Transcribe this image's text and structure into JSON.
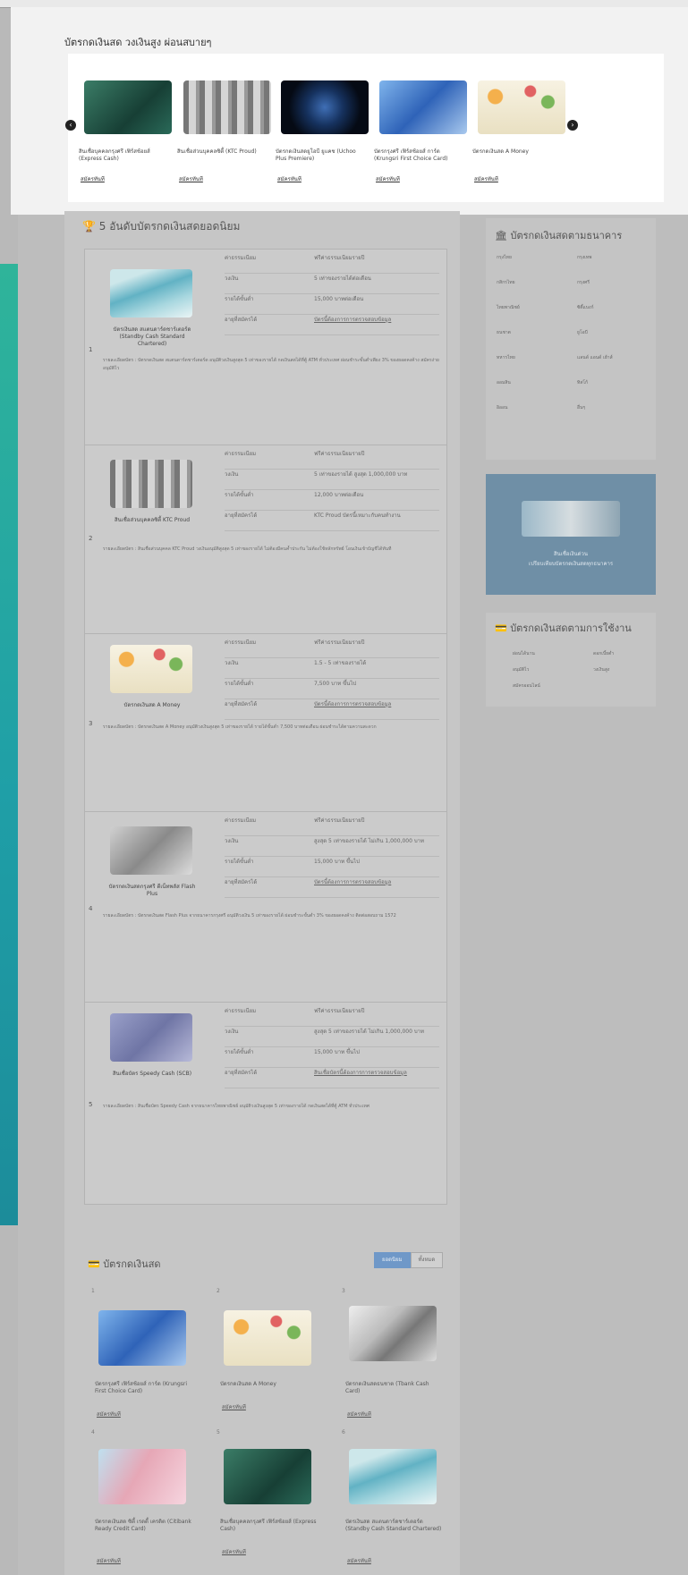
{
  "popup": {
    "title": "บัตรกดเงินสด วงเงินสูง ผ่อนสบายๆ",
    "cards": [
      {
        "caption": "สินเชื่อบุคคลกรุงศรี เฟิร์สช้อยส์ (Express Cash)",
        "link": "สมัครทันที"
      },
      {
        "caption": "สินเชื่อส่วนบุคคลซิตี้ (KTC Proud)",
        "link": "สมัครทันที"
      },
      {
        "caption": "บัตรกดเงินสดยูโอบี ยูแคช (Uchoo Plus Premiere)",
        "link": "สมัครทันที"
      },
      {
        "caption": "บัตรกรุงศรี เฟิร์สช้อยส์ การ์ด (Krungsri First Choice Card)",
        "link": "สมัครทันที"
      },
      {
        "caption": "บัตรกดเงินสด A Money",
        "link": "สมัครทันที"
      }
    ]
  },
  "main": {
    "title": "5 อันดับบัตรกดเงินสดยอดนิยม",
    "field_labels": [
      "ค่าธรรมเนียม",
      "วงเงิน",
      "รายได้ขั้นต่ำ",
      "อายุที่สมัครได้"
    ],
    "rows": [
      {
        "num": "1",
        "name": "บัตรเงินสด สแตนดาร์ดชาร์เตอร์ด (Standby Cash Standard Chartered)",
        "values": [
          "ฟรีค่าธรรมเนียมรายปี",
          "5 เท่าของรายได้ต่อเดือน",
          "15,000 บาทต่อเดือน",
          "บัตรนี้ต้องการการตรวจสอบข้อมูล"
        ],
        "detail": "รายละเอียดบัตร : บัตรกดเงินสด สแตนดาร์ดชาร์เตอร์ด อนุมัติวงเงินสูงสุด 5 เท่าของรายได้ กดเงินสดได้ที่ตู้ ATM ทั่วประเทศ ผ่อนชำระขั้นต่ำเพียง 3% ของยอดคงค้าง สมัครง่าย อนุมัติไว"
      },
      {
        "num": "2",
        "name": "สินเชื่อส่วนบุคคลซิตี้ KTC Proud",
        "values": [
          "ฟรีค่าธรรมเนียมรายปี",
          "5 เท่าของรายได้ สูงสุด 1,000,000 บาท",
          "12,000 บาทต่อเดือน",
          "KTC Proud บัตรนี้เหมาะกับคนทำงาน"
        ],
        "detail": "รายละเอียดบัตร : สินเชื่อส่วนบุคคล KTC Proud วงเงินอนุมัติสูงสุด 5 เท่าของรายได้ ไม่ต้องมีคนค้ำประกัน ไม่ต้องใช้หลักทรัพย์ โอนเงินเข้าบัญชีได้ทันที"
      },
      {
        "num": "3",
        "name": "บัตรกดเงินสด A Money",
        "values": [
          "ฟรีค่าธรรมเนียมรายปี",
          "1.5 - 5 เท่าของรายได้",
          "7,500 บาท ขึ้นไป",
          "บัตรนี้ต้องการการตรวจสอบข้อมูล"
        ],
        "detail": "รายละเอียดบัตร : บัตรกดเงินสด A Money อนุมัติวงเงินสูงสุด 5 เท่าของรายได้ รายได้ขั้นต่ำ 7,500 บาทต่อเดือน ผ่อนชำระได้ตามความสะดวก"
      },
      {
        "num": "4",
        "name": "บัตรกดเงินสดกรุงศรี ดีเน็ทพลัส Flash Plus",
        "values": [
          "ฟรีค่าธรรมเนียมรายปี",
          "สูงสุด 5 เท่าของรายได้ ไม่เกิน 1,000,000 บาท",
          "15,000 บาท ขึ้นไป",
          "บัตรนี้ต้องการการตรวจสอบข้อมูล"
        ],
        "detail": "รายละเอียดบัตร : บัตรกดเงินสด Flash Plus จากธนาคารกรุงศรี อนุมัติวงเงิน 5 เท่าของรายได้ ผ่อนชำระขั้นต่ำ 3% ของยอดคงค้าง ติดต่อสอบถาม 1572"
      },
      {
        "num": "5",
        "name": "สินเชื่อบัตร Speedy Cash (SCB)",
        "values": [
          "ฟรีค่าธรรมเนียมรายปี",
          "สูงสุด 5 เท่าของรายได้ ไม่เกิน 1,000,000 บาท",
          "15,000 บาท ขึ้นไป",
          "สินเชื่อบัตรนี้ต้องการการตรวจสอบข้อมูล"
        ],
        "detail": "รายละเอียดบัตร : สินเชื่อบัตร Speedy Cash จากธนาคารไทยพาณิชย์ อนุมัติวงเงินสูงสุด 5 เท่าของรายได้ กดเงินสดได้ที่ตู้ ATM ทั่วประเทศ"
      }
    ]
  },
  "sidebar": {
    "banks_title": "บัตรกดเงินสดตามธนาคาร",
    "banks": [
      "กรุงไทย",
      "กรุงเทพ",
      "กสิกรไทย",
      "กรุงศรี",
      "ไทยพาณิชย์",
      "ซิตี้แบงก์",
      "ธนชาต",
      "ยูโอบี",
      "ทหารไทย",
      "แลนด์ แอนด์ เฮ้าส์",
      "ออมสิน",
      "ทิสโก้",
      "อิออน",
      "อื่นๆ"
    ],
    "banner_line1": "สินเชื่อเงินด่วน",
    "banner_line2": "เปรียบเทียบบัตรกดเงินสดทุกธนาคาร",
    "usage_title": "บัตรกดเงินสดตามการใช้งาน",
    "usage_items": [
      "ผ่อนได้นาน",
      "ดอกเบี้ยต่ำ",
      "อนุมัติไว",
      "วงเงินสูง",
      "สมัครออนไลน์"
    ]
  },
  "bottom": {
    "title": "บัตรกดเงินสด",
    "tabs": [
      "ยอดนิยม",
      "ทั้งหมด"
    ],
    "cards": [
      {
        "num": "1",
        "caption": "บัตรกรุงศรี เฟิร์สช้อยส์ การ์ด (Krungsri First Choice Card)",
        "link": "สมัครทันที"
      },
      {
        "num": "2",
        "caption": "บัตรกดเงินสด A Money",
        "link": "สมัครทันที"
      },
      {
        "num": "3",
        "caption": "บัตรกดเงินสดธนชาต (Tbank Cash Card)",
        "link": "สมัครทันที"
      },
      {
        "num": "4",
        "caption": "บัตรกดเงินสด ซิตี้ เรดดี้ เครดิต (Citibank Ready Credit Card)",
        "link": "สมัครทันที"
      },
      {
        "num": "5",
        "caption": "สินเชื่อบุคคลกรุงศรี เฟิร์สช้อยส์ (Express Cash)",
        "link": "สมัครทันที"
      },
      {
        "num": "6",
        "caption": "บัตรเงินสด สแตนดาร์ดชาร์เตอร์ด (Standby Cash Standard Chartered)",
        "link": "สมัครทันที"
      }
    ]
  }
}
